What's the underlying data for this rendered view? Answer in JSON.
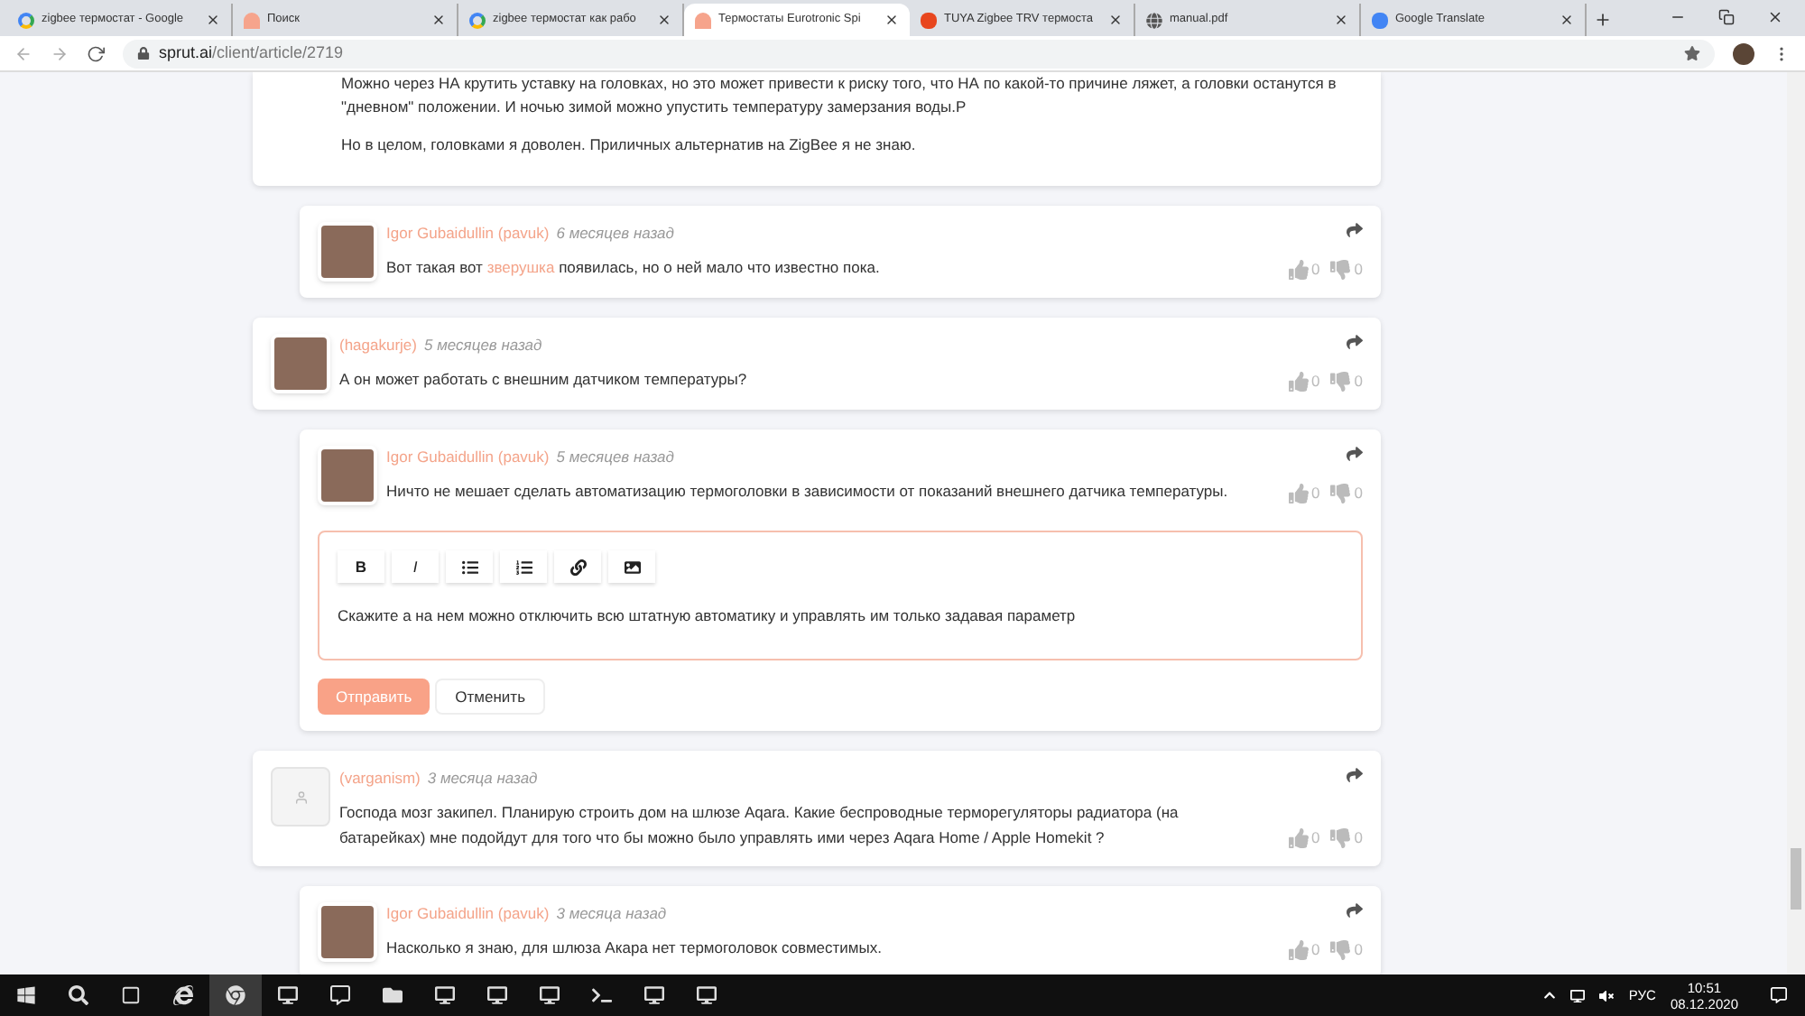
{
  "browser": {
    "tabs": [
      {
        "title": "zigbee термостат - Google",
        "selected": false
      },
      {
        "title": "Поиск",
        "selected": false
      },
      {
        "title": "zigbee термостат как рабо",
        "selected": false
      },
      {
        "title": "Термостаты Eurotronic Spi",
        "selected": true
      },
      {
        "title": "TUYA Zigbee TRV термоста",
        "selected": false
      },
      {
        "title": "manual.pdf",
        "selected": false
      },
      {
        "title": "Google Translate",
        "selected": false
      }
    ],
    "url_host": "sprut.ai",
    "url_path": "/client/article/2719"
  },
  "article_tail": {
    "paragraphs": [
      "Можно через НА крутить уставку на головках, но это может привести к риску того, что НА по какой-то причине ляжет, а головки останутся в \"дневном\" положении. И ночью зимой можно упустить температуру замерзания воды.P",
      "Но в целом, головками я доволен. Приличных альтернатив на ZigBee я не знаю."
    ]
  },
  "comments": [
    {
      "nested": true,
      "author": "Igor Gubaidullin (pavuk)",
      "time": "6 месяцев назад",
      "body": [
        {
          "kind": "text",
          "text": "Вот такая вот "
        },
        {
          "kind": "link",
          "text": "зверушка"
        },
        {
          "kind": "text",
          "text": " появилась, но о ней мало что известно пока."
        }
      ],
      "likes": "0",
      "dislikes": "0"
    },
    {
      "nested": false,
      "author": "(hagakurje)",
      "time": "5 месяцев назад",
      "body": [
        {
          "kind": "text",
          "text": "А он может работать с внешним датчиком температуры?"
        }
      ],
      "likes": "0",
      "dislikes": "0"
    },
    {
      "nested": true,
      "author": "Igor Gubaidullin (pavuk)",
      "time": "5 месяцев назад",
      "body": [
        {
          "kind": "text",
          "text": "Ничто не мешает сделать автоматизацию термоголовки в зависимости от показаний внешнего датчика температуры."
        }
      ],
      "likes": "0",
      "dislikes": "0",
      "reply_editor": {
        "toolbar": [
          {
            "kind": "bold",
            "label": "B"
          },
          {
            "kind": "italic",
            "label": "I"
          },
          {
            "kind": "bullets"
          },
          {
            "kind": "numbers"
          },
          {
            "kind": "link"
          },
          {
            "kind": "image"
          }
        ],
        "value": "Скажите а на нем можно отключить всю штатную автоматику и управлять им только задавая параметр",
        "submit": "Отправить",
        "cancel": "Отменить"
      }
    },
    {
      "nested": false,
      "author": "(varganism)",
      "time": "3 месяца назад",
      "body": [
        {
          "kind": "text",
          "text": "Господа мозг закипел. Планирую строить дом на шлюзе Aqara. Какие беспроводные терморегуляторы радиатора (на батарейках) мне подойдут для того что бы можно было управлять ими через Aqara Home / Apple Homekit ?"
        }
      ],
      "likes": "0",
      "dislikes": "0"
    },
    {
      "nested": true,
      "author": "Igor Gubaidullin (pavuk)",
      "time": "3 месяца назад",
      "body": [
        {
          "kind": "text",
          "text": "Насколько я знаю, для шлюза Акара нет термоголовок совместимых."
        }
      ],
      "likes": "0",
      "dislikes": "0"
    }
  ],
  "taskbar": {
    "language": "РУС",
    "time": "10:51",
    "date": "08.12.2020"
  }
}
